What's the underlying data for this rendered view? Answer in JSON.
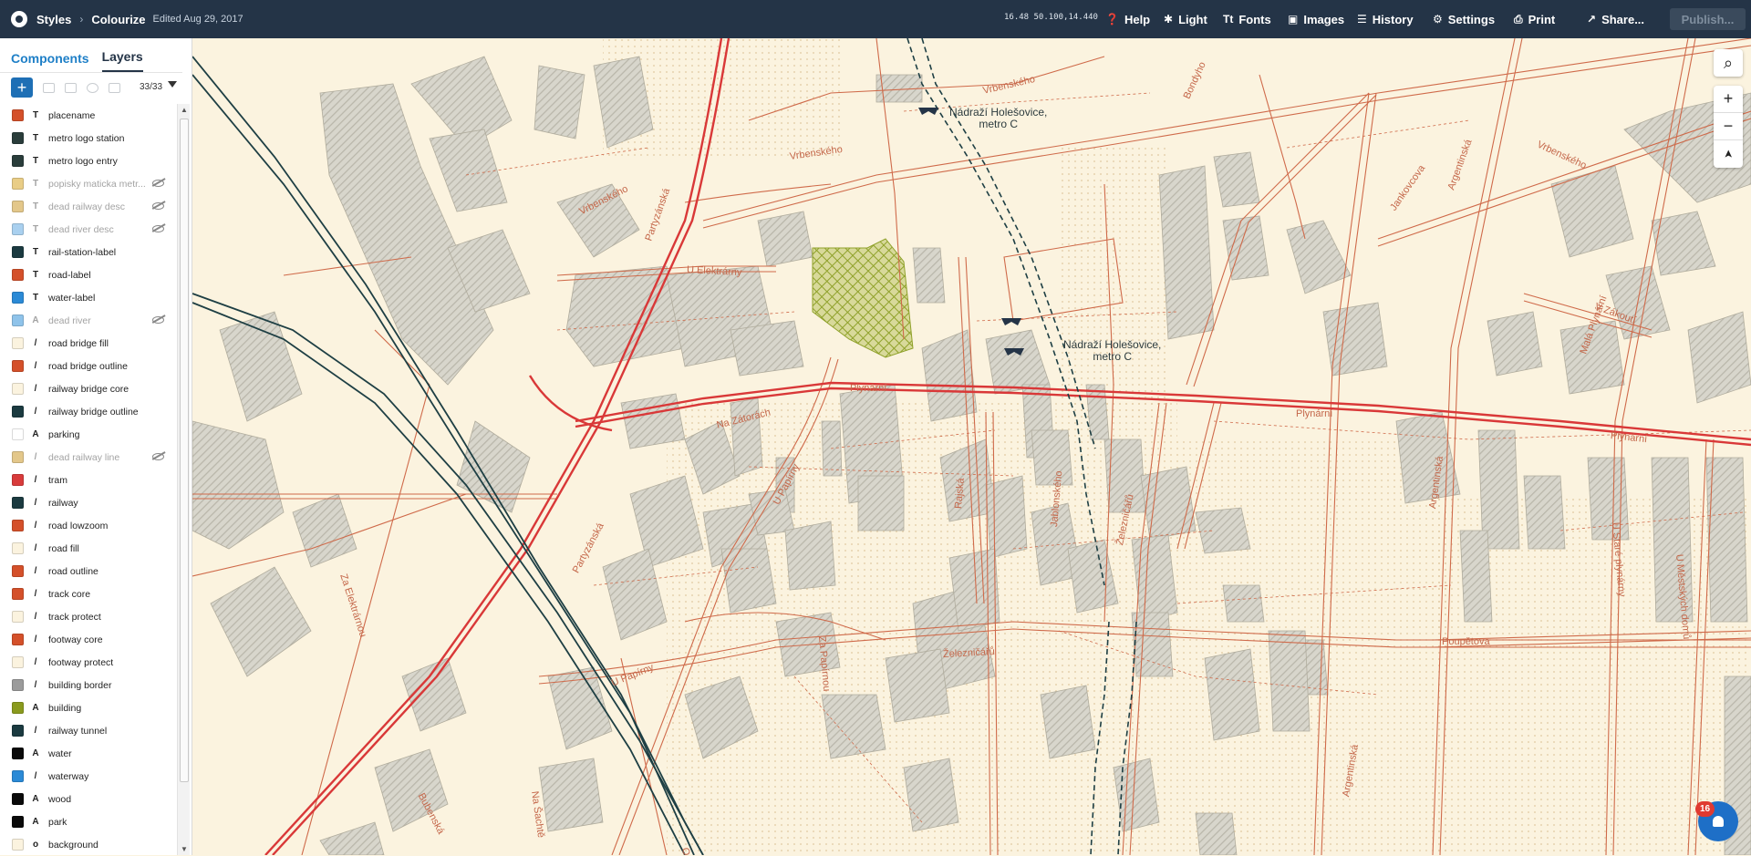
{
  "topbar": {
    "crumbs": [
      "Styles",
      "Colourize"
    ],
    "edited": "Edited Aug 29, 2017",
    "coords": "16.48  50.100,14.440",
    "items": {
      "help": "Help",
      "light": "Light",
      "fonts": "Fonts",
      "images": "Images",
      "history": "History",
      "settings": "Settings",
      "print": "Print",
      "share": "Share..."
    },
    "publish": "Publish..."
  },
  "sidebar": {
    "tabs": [
      "Components",
      "Layers"
    ],
    "count": "33/33",
    "add": "+",
    "layers": [
      {
        "name": "placename",
        "type": "T",
        "color": "#d4502a",
        "dim": false
      },
      {
        "name": "metro logo station",
        "type": "T",
        "color": "#2a3d3b",
        "dim": false
      },
      {
        "name": "metro logo entry",
        "type": "T",
        "color": "#2a3d3b",
        "dim": false
      },
      {
        "name": "popisky maticka metr...",
        "type": "T",
        "color": "#e9cd86",
        "dim": true
      },
      {
        "name": "dead railway desc",
        "type": "T",
        "color": "#e3c78a",
        "dim": true
      },
      {
        "name": "dead river desc",
        "type": "T",
        "color": "#a9d0ef",
        "dim": true
      },
      {
        "name": "rail-station-label",
        "type": "T",
        "color": "#1b3a40",
        "dim": false
      },
      {
        "name": "road-label",
        "type": "T",
        "color": "#d4502a",
        "dim": false
      },
      {
        "name": "water-label",
        "type": "T",
        "color": "#2b8ad6",
        "dim": false
      },
      {
        "name": "dead river",
        "type": "A",
        "color": "#8fc3ea",
        "dim": true
      },
      {
        "name": "road bridge fill",
        "type": "/",
        "color": "#fbf3df",
        "dim": false
      },
      {
        "name": "road bridge outline",
        "type": "/",
        "color": "#d4502a",
        "dim": false
      },
      {
        "name": "railway bridge core",
        "type": "/",
        "color": "#fbf3df",
        "dim": false
      },
      {
        "name": "railway bridge outline",
        "type": "/",
        "color": "#1b3a40",
        "dim": false
      },
      {
        "name": "parking",
        "type": "A",
        "color": "#ffffff",
        "dim": false
      },
      {
        "name": "dead railway line",
        "type": "/",
        "color": "#e3c78a",
        "dim": true
      },
      {
        "name": "tram",
        "type": "/",
        "color": "#d83b3b",
        "dim": false
      },
      {
        "name": "railway",
        "type": "/",
        "color": "#1b3a40",
        "dim": false
      },
      {
        "name": "road lowzoom",
        "type": "/",
        "color": "#d4502a",
        "dim": false
      },
      {
        "name": "road fill",
        "type": "/",
        "color": "#fbf3df",
        "dim": false
      },
      {
        "name": "road outline",
        "type": "/",
        "color": "#d4502a",
        "dim": false
      },
      {
        "name": "track core",
        "type": "/",
        "color": "#d4502a",
        "dim": false
      },
      {
        "name": "track protect",
        "type": "/",
        "color": "#fbf3df",
        "dim": false
      },
      {
        "name": "footway core",
        "type": "/",
        "color": "#d4502a",
        "dim": false
      },
      {
        "name": "footway protect",
        "type": "/",
        "color": "#fbf3df",
        "dim": false
      },
      {
        "name": "building border",
        "type": "/",
        "color": "#9b9b9b",
        "dim": false
      },
      {
        "name": "building",
        "type": "A",
        "color": "#8a9a1e",
        "dim": false
      },
      {
        "name": "railway tunnel",
        "type": "/",
        "color": "#1b3a40",
        "dim": false
      },
      {
        "name": "water",
        "type": "A",
        "color": "#0a0a0a",
        "dim": false
      },
      {
        "name": "waterway",
        "type": "/",
        "color": "#2b8ad6",
        "dim": false
      },
      {
        "name": "wood",
        "type": "A",
        "color": "#0a0a0a",
        "dim": false
      },
      {
        "name": "park",
        "type": "A",
        "color": "#0a0a0a",
        "dim": false
      },
      {
        "name": "background",
        "type": "o",
        "color": "#fbf3df",
        "dim": false
      }
    ]
  },
  "map": {
    "labels": {
      "vrbenskeho1": "Vrbenského",
      "vrbenskeho2": "Vrbenského",
      "vrbenskeho3": "Vrbenského",
      "vrbenskeho4": "Vrbenského",
      "u_elektrarny": "U Elektrárny",
      "na_zatorach": "Na Zátorách",
      "plynarni1": "Plynární",
      "plynarni2": "Plynární",
      "plynarni3": "Plynární",
      "partyzanska1": "Partyzánská",
      "partyzanska2": "Partyzánská",
      "u_papirny1": "U Papírny",
      "u_papirny2": "U Papírny",
      "za_papirnou": "Za Papírnou",
      "za_elektrarnou": "Za Elektrárnou",
      "bubenska": "Bubenská",
      "na_sachte": "Na Šachtě",
      "rajska": "Rajská",
      "zeleznicaru1": "Železničářů",
      "zeleznicaru2": "Železničářů",
      "argentinska1": "Argentinská",
      "argentinska2": "Argentinská",
      "argentinska3": "Argentinská",
      "jankovcova": "Jankovcova",
      "v_zakouti": "V Zákoutí",
      "mala_plynarni": "Malá Plynární",
      "u_stare_plynarny": "U Staré plynárny",
      "u_mestskych_domu": "U Městských domů",
      "poupetova": "Poupětova",
      "bondyho": "Bondyho",
      "jablonskeho": "Jablonského",
      "ortenovo": "Ortenovo"
    },
    "stations": {
      "s1_line1": "Nádraží Holešovice,",
      "s1_line2": "metro C",
      "s2_line1": "Nádraží Holešovice,",
      "s2_line2": "metro C"
    },
    "controls": {
      "search": "⌕",
      "zoom_in": "+",
      "zoom_out": "−",
      "compass": "➤"
    },
    "notifications": "16"
  }
}
